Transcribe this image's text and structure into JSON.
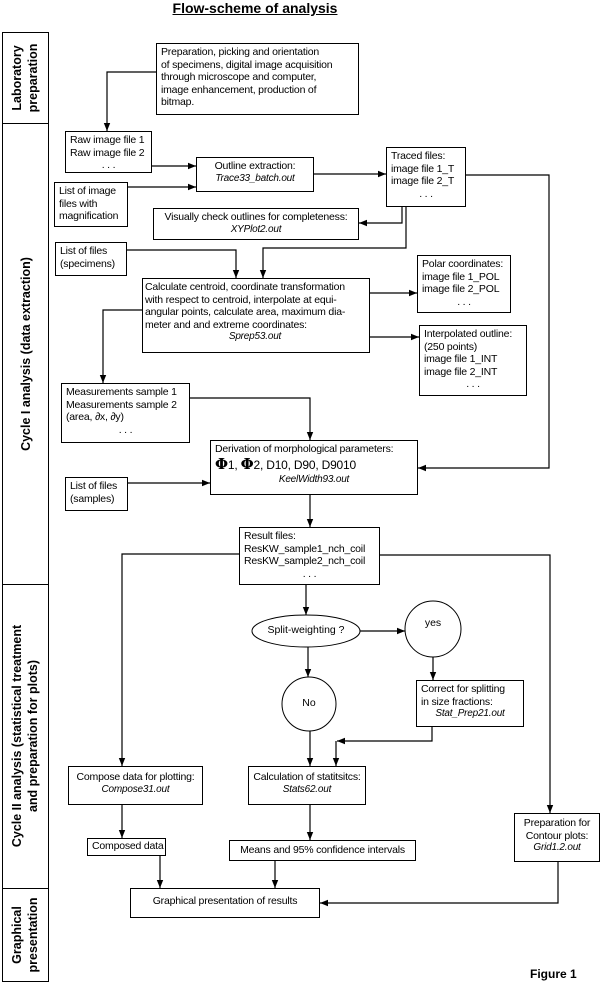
{
  "title": "Flow-scheme of analysis",
  "figure_label": "Figure 1",
  "phases": {
    "lab": [
      "Laboratory",
      "preparation"
    ],
    "cycle1": [
      "Cycle I analysis (data extraction)"
    ],
    "cycle2": [
      "Cycle II analysis (statistical treatment",
      "and preparation for plots)"
    ],
    "graph": [
      "Graphical",
      "presentation"
    ]
  },
  "nodes": {
    "prep": [
      "Preparation, picking and orientation",
      "of specimens, digital image acquisition",
      "through microscope and computer,",
      "image enhancement, production of",
      "bitmap."
    ],
    "raw": [
      "Raw image file 1",
      "Raw image file 2",
      ". . ."
    ],
    "outline": {
      "lines": [
        "Outline extraction:"
      ],
      "program": "Trace33_batch.out"
    },
    "list_images": [
      "List of image",
      "files with",
      "magnification"
    ],
    "traced": [
      "Traced files:",
      "image file 1_T",
      "image file 2_T",
      ". . ."
    ],
    "visual": {
      "lines": [
        "Visually check outlines for completeness:"
      ],
      "program": "XYPlot2.out"
    },
    "list_specimens": [
      "List of files",
      "(specimens)"
    ],
    "calc": {
      "lines": [
        "Calculate centroid, coordinate transformation",
        "with respect to centroid, interpolate at equi-",
        "angular points, calculate area, maximum dia-",
        "meter and and extreme coordinates:"
      ],
      "program": "Sprep53.out"
    },
    "polar": [
      "Polar coordinates:",
      "image file 1_POL",
      "image file 2_POL",
      ". . ."
    ],
    "interp": [
      "Interpolated outline:",
      "(250 points)",
      "image file 1_INT",
      "image file 2_INT",
      ". . ."
    ],
    "measurements": [
      "Measurements sample 1",
      "Measurements sample 2",
      "(area, ∂x, ∂y)",
      ". . ."
    ],
    "derivation": {
      "lines": [
        "Derivation of morphological parameters:"
      ],
      "phi1": "Φ",
      "phi1_sub": "1, ",
      "phi2": "Φ",
      "phi2_sub": "2, D10, D90, D9010",
      "program": "KeelWidth93.out"
    },
    "list_samples": [
      "List of files",
      "(samples)"
    ],
    "result": [
      "Result files:",
      "ResKW_sample1_nch_coil",
      "ResKW_sample2_nch_coil",
      ". . ."
    ],
    "split": "Split-weighting ?",
    "yes": "yes",
    "no": "No",
    "correct": {
      "lines": [
        "Correct for splitting",
        "in size fractions:"
      ],
      "program": "Stat_Prep21.out"
    },
    "compose": {
      "lines": [
        "Compose data for plotting:"
      ],
      "program": "Compose31.out"
    },
    "stats": {
      "lines": [
        "Calculation of statitsitcs:"
      ],
      "program": "Stats62.out"
    },
    "composed": "Composed data",
    "means": "Means and 95% confidence intervals",
    "contour": {
      "lines": [
        "Preparation for",
        "Contour plots:"
      ],
      "program": "Grid1.2.out"
    },
    "graphical": "Graphical presentation of results"
  }
}
